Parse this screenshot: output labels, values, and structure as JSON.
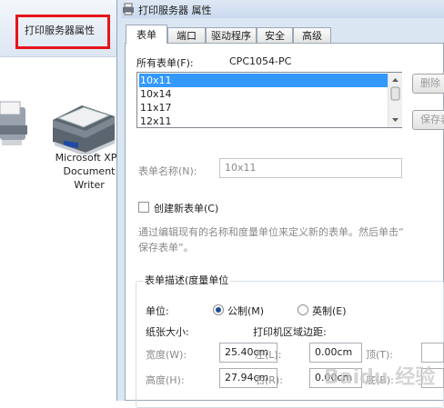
{
  "background_window": {
    "toolbar_button": "打印服务器属性",
    "printer_label_lines": [
      "Microsoft XPS",
      "Document",
      "Writer"
    ]
  },
  "dialog": {
    "title": "打印服务器 属性",
    "tabs": [
      {
        "label": "表单",
        "active": true
      },
      {
        "label": "端口",
        "active": false
      },
      {
        "label": "驱动程序",
        "active": false
      },
      {
        "label": "安全",
        "active": false
      },
      {
        "label": "高级",
        "active": false
      }
    ],
    "all_forms_label": "所有表单(F):",
    "server_name": "CPC1054-PC",
    "forms_list": [
      "10x11",
      "10x14",
      "11x17",
      "12x11"
    ],
    "selected_form": "10x11",
    "delete_button": "删除",
    "save_button": "保存表",
    "form_name_label": "表单名称(N):",
    "form_name_value": "10x11",
    "create_new_label": "创建新表单(C)",
    "hint_line1": "通过编辑现有的名称和度量单位来定义新的表单。然后单击“",
    "hint_line2": "保存表单”。",
    "group_title": "表单描述(度量单位",
    "unit_label": "单位:",
    "metric_label": "公制(M)",
    "imperial_label": "英制(E)",
    "paper_size_label": "纸张大小:",
    "margin_label": "打印机区域边距:",
    "width_label": "宽度(W):",
    "width_value": "25.40cm",
    "height_label": "高度(H):",
    "height_value": "27.94cm",
    "left_label": "左(L):",
    "left_value": "0.00cm",
    "right_label": "右(R):",
    "right_value": "0.00cm",
    "top_label": "顶(T):",
    "bottom_label": "底(B):"
  },
  "watermark": "Baidu 经验",
  "colors": {
    "highlight": "#e8141b",
    "selection": "#3399ff",
    "dialog_bg": "#dbe6f3"
  }
}
